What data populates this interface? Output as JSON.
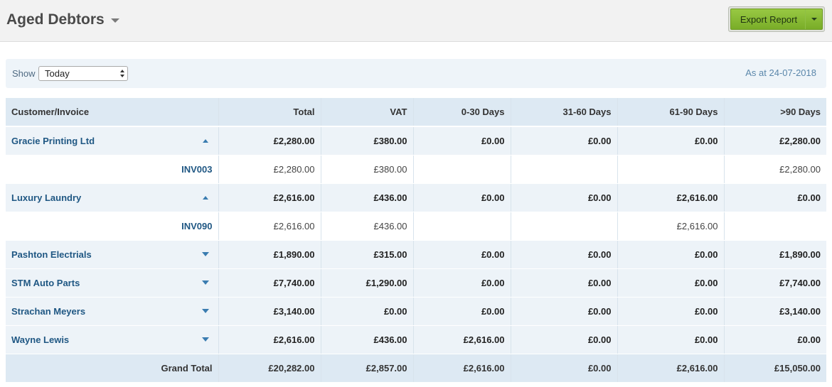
{
  "header": {
    "title": "Aged Debtors",
    "export_label": "Export Report"
  },
  "filter": {
    "show_label": "Show",
    "show_value": "Today",
    "as_at": "As at 24-07-2018"
  },
  "columns": [
    "Customer/Invoice",
    "Total",
    "VAT",
    "0-30 Days",
    "31-60 Days",
    "61-90 Days",
    ">90 Days"
  ],
  "rows": [
    {
      "name": "Gracie Printing Ltd",
      "expanded": true,
      "values": [
        "£2,280.00",
        "£380.00",
        "£0.00",
        "£0.00",
        "£0.00",
        "£2,280.00"
      ]
    },
    {
      "invoice": "INV003",
      "values": [
        "£2,280.00",
        "£380.00",
        "",
        "",
        "",
        "£2,280.00"
      ]
    },
    {
      "name": "Luxury Laundry",
      "expanded": true,
      "values": [
        "£2,616.00",
        "£436.00",
        "£0.00",
        "£0.00",
        "£2,616.00",
        "£0.00"
      ]
    },
    {
      "invoice": "INV090",
      "values": [
        "£2,616.00",
        "£436.00",
        "",
        "",
        "£2,616.00",
        ""
      ]
    },
    {
      "name": "Pashton Electrials",
      "expanded": false,
      "values": [
        "£1,890.00",
        "£315.00",
        "£0.00",
        "£0.00",
        "£0.00",
        "£1,890.00"
      ]
    },
    {
      "name": "STM Auto Parts",
      "expanded": false,
      "values": [
        "£7,740.00",
        "£1,290.00",
        "£0.00",
        "£0.00",
        "£0.00",
        "£7,740.00"
      ]
    },
    {
      "name": "Strachan Meyers",
      "expanded": false,
      "values": [
        "£3,140.00",
        "£0.00",
        "£0.00",
        "£0.00",
        "£0.00",
        "£3,140.00"
      ]
    },
    {
      "name": "Wayne Lewis",
      "expanded": false,
      "values": [
        "£2,616.00",
        "£436.00",
        "£2,616.00",
        "£0.00",
        "£0.00",
        "£0.00"
      ]
    }
  ],
  "grand_total": {
    "label": "Grand Total",
    "values": [
      "£20,282.00",
      "£2,857.00",
      "£2,616.00",
      "£0.00",
      "£2,616.00",
      "£15,050.00"
    ]
  },
  "colors": {
    "accent_green": "#79ad28",
    "link_blue": "#1f5783",
    "header_bg": "#dde9f3",
    "row_bg": "#edf3f8"
  },
  "icons": {
    "title_menu": "chevron-down-icon",
    "export_menu": "chevron-down-icon",
    "collapse": "triangle-up-icon",
    "expand": "triangle-down-icon"
  }
}
